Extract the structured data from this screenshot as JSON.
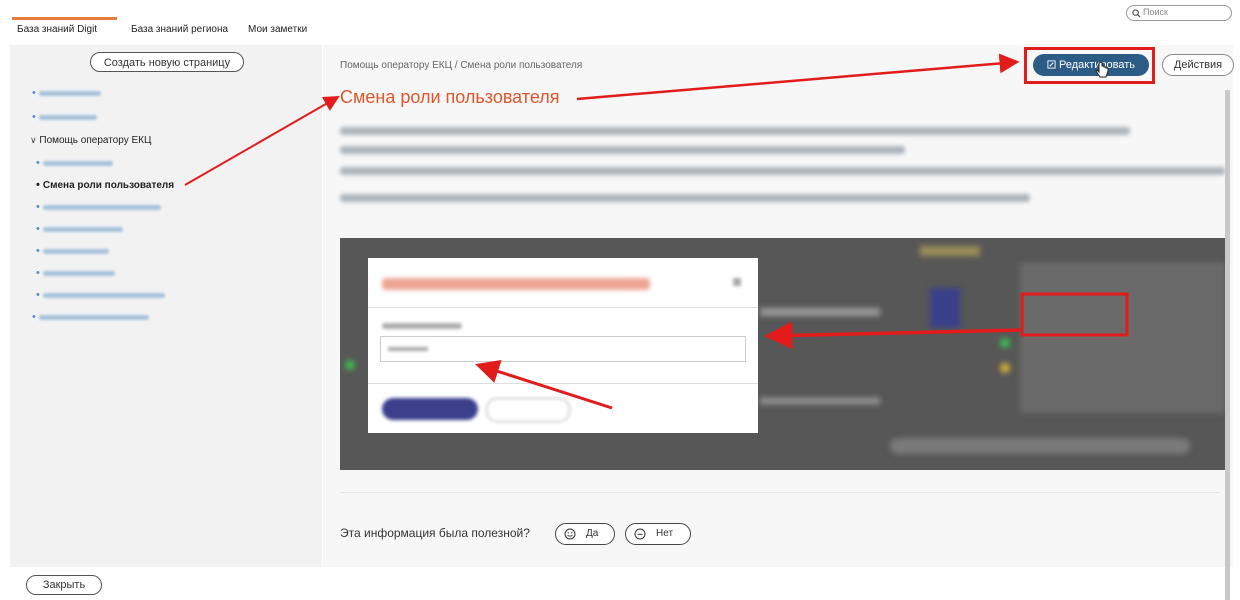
{
  "tabs": [
    {
      "label": "База знаний Digit",
      "active": true
    },
    {
      "label": "База знаний региона",
      "active": false
    },
    {
      "label": "Мои заметки",
      "active": false
    }
  ],
  "search": {
    "placeholder": "Поиск"
  },
  "sidebar": {
    "create_button": "Создать новую страницу",
    "group_label": "Помощь оператору ЕКЦ",
    "current_item": "Смена роли пользователя"
  },
  "breadcrumb": {
    "text": "Помощь оператору ЕКЦ / Смена роли пользователя"
  },
  "toolbar": {
    "edit_label": "Редактировать",
    "actions_label": "Действия"
  },
  "page": {
    "title": "Смена роли пользователя"
  },
  "feedback": {
    "question": "Эта информация была полезной?",
    "yes_label": "Да",
    "no_label": "Нет"
  },
  "footer": {
    "close_label": "Закрыть"
  },
  "colors": {
    "accent": "#e0552a",
    "primary": "#2c5b86",
    "annotation": "#e21b1b"
  },
  "icons": {
    "search": "search-icon",
    "edit": "edit-icon",
    "caret": "chevron-down-icon",
    "yes": "smile-icon",
    "no": "neutral-face-icon",
    "cursor": "hand-cursor-icon"
  }
}
